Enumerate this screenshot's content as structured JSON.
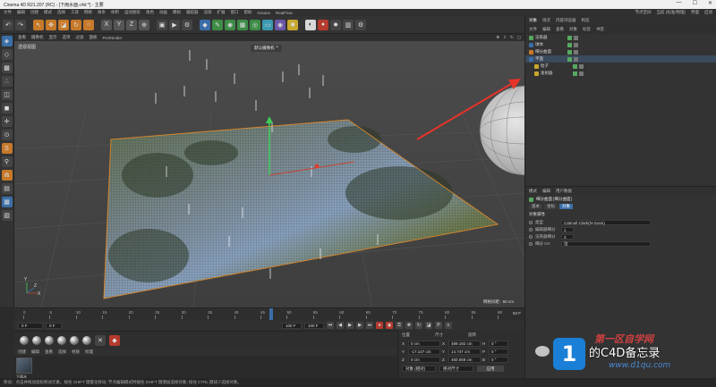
{
  "window": {
    "title": "Cinema 4D R21.207 (RC) - [下雨水面.c4d *] - 主要",
    "controls": [
      "—",
      "☐",
      "✕"
    ]
  },
  "menubar": {
    "items": [
      "文件",
      "编辑",
      "创建",
      "模式",
      "选择",
      "工具",
      "网格",
      "样条",
      "体积",
      "运动图形",
      "角色",
      "动画",
      "模拟",
      "跟踪器",
      "渲染",
      "扩展",
      "窗口",
      "帮助",
      "Octane",
      "RealFlow"
    ],
    "right": [
      "节点空间",
      "当前 (标准/物理)",
      "界面",
      "启动"
    ]
  },
  "viewport": {
    "menu": [
      "查看",
      "摄像机",
      "显示",
      "选项",
      "过滤",
      "面板",
      "ProRender"
    ],
    "label": "透视视图",
    "camera": "默认摄像机 °°",
    "grid_spacing": "网格间距 : 50 cm",
    "axis_x": "X",
    "axis_y": "Y",
    "axis_z": "Z"
  },
  "timeline": {
    "ticks": [
      "0",
      "5",
      "10",
      "15",
      "20",
      "25",
      "30",
      "35",
      "40",
      "45",
      "50",
      "55",
      "60",
      "65",
      "70",
      "75",
      "80",
      "85",
      "90"
    ],
    "end_label": "50 F"
  },
  "transport": {
    "frame_start": "0 F",
    "frame_current": "0 F",
    "frame_end": "100 F",
    "frame_end2": "100 F"
  },
  "material": {
    "menu": [
      "创建",
      "编辑",
      "查看",
      "选择",
      "材质",
      "纹理"
    ],
    "thumb_label": "下雨水"
  },
  "coords": {
    "headers": [
      "位置",
      "尺寸",
      "旋转"
    ],
    "rows": [
      {
        "a": "X",
        "pos": "0 cm",
        "b": "X",
        "size": "489.192 cm",
        "c": "H",
        "rot": "0 °"
      },
      {
        "a": "Y",
        "pos": "-17.147 cm",
        "b": "Y",
        "size": "14.747 cm",
        "c": "P",
        "rot": "0 °"
      },
      {
        "a": "Z",
        "pos": "0 cm",
        "b": "Z",
        "size": "460.069 cm",
        "c": "B",
        "rot": "0 °"
      }
    ],
    "mode1": "对象 (相对)",
    "mode2": "绝对尺寸",
    "apply": "应用"
  },
  "statusbar": {
    "text": "移动：点击并拖动鼠标移动元素。按住 SHIFT 键量化移动; 节点编辑模式时按住 SHIFT 键增加选择对象; 按住 CTRL 键减少选择对象。"
  },
  "object_manager": {
    "tabs": [
      "对象",
      "场次",
      "内容浏览器",
      "构造"
    ],
    "menu": [
      "文件",
      "编辑",
      "查看",
      "对象",
      "标签",
      "书签"
    ],
    "rows": [
      {
        "name": "渲染器",
        "color": "#56a85f",
        "selected": false
      },
      {
        "name": "球体",
        "color": "#3a6ea8",
        "selected": false
      },
      {
        "name": "细分曲面",
        "color": "#c7792a",
        "selected": false
      },
      {
        "name": "平面",
        "color": "#3a6ea8",
        "selected": true
      },
      {
        "name": "粒子",
        "color": "#c8a72e",
        "selected": false
      },
      {
        "name": "发射器",
        "color": "#c8a72e",
        "selected": false
      }
    ]
  },
  "attribute_manager": {
    "tabs": [
      "模式",
      "编辑",
      "用户数据"
    ],
    "title": "细分曲面 [细分曲面]",
    "subtabs": [
      "基本",
      "坐标",
      "对象"
    ],
    "section": "对象属性",
    "rows": [
      {
        "label": "类型",
        "value": "Catmull-Clark(N-Gons)"
      },
      {
        "label": "编辑器细分",
        "value": "1"
      },
      {
        "label": "渲染器细分",
        "value": "3"
      },
      {
        "label": "细分 UV",
        "value": "边"
      }
    ]
  },
  "watermark": {
    "logo": "1",
    "top": "第一区自学网",
    "text": "的C4D备忘录",
    "url": "www.d1qu.com"
  }
}
